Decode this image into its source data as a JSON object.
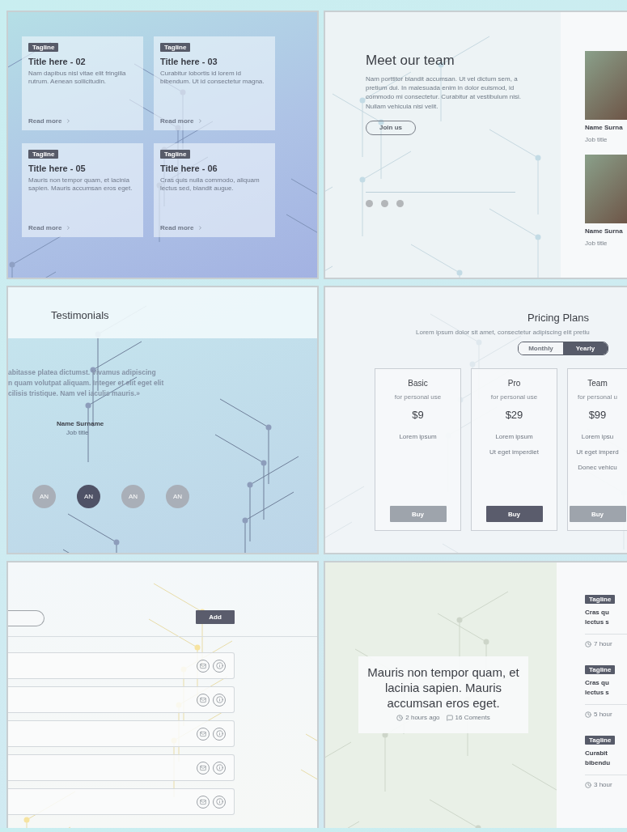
{
  "blog_cards_panel": {
    "cards": [
      {
        "tag": "Tagline",
        "title": "Title here - 02",
        "text": "Nam dapibus nisl vitae elit fringilla rutrum. Aenean sollicitudin.",
        "link": "Read more"
      },
      {
        "tag": "Tagline",
        "title": "Title here - 03",
        "text": "Curabitur lobortis id lorem id bibendum. Ut id consectetur magna.",
        "link": "Read more"
      },
      {
        "tag": "Tagline",
        "title": "Title here - 05",
        "text": "Mauris non tempor quam, et lacinia sapien. Mauris accumsan eros eget.",
        "link": "Read more"
      },
      {
        "tag": "Tagline",
        "title": "Title here - 06",
        "text": "Cras quis nulla commodo, aliquam lectus sed, blandit augue.",
        "link": "Read more"
      }
    ]
  },
  "team_panel": {
    "title": "Meet our team",
    "text": "Nam porttitor blandit accumsan. Ut vel dictum sem, a pretium dui. In malesuada enim in dolor euismod, id commodo mi consectetur. Curabitur at vestibulum nisi. Nullam vehicula nisi velit.",
    "button": "Join us",
    "members": [
      {
        "name": "Name Surna",
        "job_title": "Job title"
      },
      {
        "name": "Name Surna",
        "job_title": "Job title"
      }
    ]
  },
  "testimonials_panel": {
    "title": "Testimonials",
    "quote_lines": [
      "abitasse platea dictumst. Vivamus adipiscing",
      "n quam volutpat aliquam. Integer et elit eget elit",
      "cilisis tristique. Nam vel iaculis mauris.»"
    ],
    "author": {
      "name": "Name Surname",
      "job_title": "Job title"
    },
    "avatars": [
      {
        "initials": "AN",
        "selected": false
      },
      {
        "initials": "AN",
        "selected": true
      },
      {
        "initials": "AN",
        "selected": false
      },
      {
        "initials": "AN",
        "selected": false
      }
    ]
  },
  "pricing_panel": {
    "title": "Pricing Plans",
    "subtitle": "Lorem ipsum dolor sit amet, consectetur adipiscing elit pretiu",
    "billing_toggle": [
      {
        "label": "Monthly",
        "selected": false
      },
      {
        "label": "Yearly",
        "selected": true
      }
    ],
    "plans": [
      {
        "name": "Basic",
        "audience": "for personal use",
        "price": "$9",
        "features": [
          "Lorem ipsum"
        ],
        "button": "Buy",
        "featured": false
      },
      {
        "name": "Pro",
        "audience": "for personal use",
        "price": "$29",
        "features": [
          "Lorem ipsum",
          "Ut eget imperdiet"
        ],
        "button": "Buy",
        "featured": true
      },
      {
        "name": "Team",
        "audience": "for personal u",
        "price": "$99",
        "features": [
          "Lorem ipsu",
          "Ut eget imperd",
          "Donec vehicu"
        ],
        "button": "Buy",
        "featured": false
      }
    ]
  },
  "list_panel": {
    "add_button": "Add",
    "rows": [
      {
        "kind": "contact"
      },
      {
        "kind": "contact"
      },
      {
        "kind": "contact"
      },
      {
        "kind": "contact"
      },
      {
        "kind": "contact"
      }
    ]
  },
  "article_panel": {
    "featured": {
      "quote": "Mauris non tempor quam, et lacinia sapien. Mauris accumsan eros eget.",
      "time": "2 hours ago",
      "comments": "16 Coments"
    },
    "items": [
      {
        "tag": "Tagline",
        "title_lines": [
          "Cras qu",
          "lectus s"
        ],
        "time": "7 hour"
      },
      {
        "tag": "Tagline",
        "title_lines": [
          "Cras qu",
          "lectus s"
        ],
        "time": "5 hour"
      },
      {
        "tag": "Tagline",
        "title_lines": [
          "Curabit",
          "bibendu"
        ],
        "time": "3 hour"
      }
    ]
  }
}
